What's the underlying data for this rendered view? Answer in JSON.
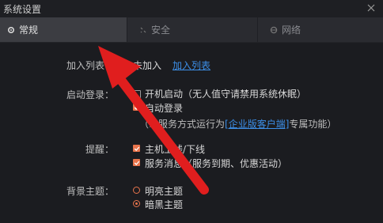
{
  "window": {
    "title": "系统设置"
  },
  "tabs": [
    {
      "label": "常规",
      "icon": "gear-icon",
      "active": true
    },
    {
      "label": "安全",
      "icon": "shield-icon",
      "active": false
    },
    {
      "label": "网络",
      "icon": "globe-icon",
      "active": false
    }
  ],
  "join_list": {
    "label": "加入列表：",
    "status": "未加入",
    "link": "加入列表"
  },
  "startup": {
    "label": "启动登录：",
    "option1": "开机启动（无人值守请禁用系统休眠）",
    "option2": "自动登录",
    "note_prefix": "（以服务方式运行为",
    "note_link": "[企业版客户端]",
    "note_suffix": "专属功能）",
    "option1_checked": false,
    "option2_checked": true
  },
  "reminder": {
    "label": "提醒：",
    "option1": "主机上线/下线",
    "option2": "服务消息（服务到期、优惠活动）",
    "option1_checked": true,
    "option2_checked": true
  },
  "theme": {
    "label": "背景主题：",
    "option1": "明亮主题",
    "option2": "暗黑主题",
    "selected": "暗黑主题"
  },
  "colors": {
    "accent": "#e8744c",
    "link": "#3c8ee6",
    "arrow": "#e01e1e"
  }
}
